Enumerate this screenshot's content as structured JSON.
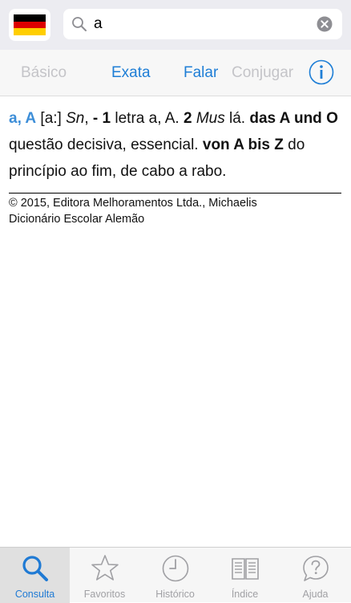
{
  "search": {
    "value": "a",
    "placeholder": ""
  },
  "language_flag": {
    "country": "Germany",
    "colors": [
      "#000000",
      "#dd0000",
      "#ffce00"
    ]
  },
  "options": {
    "basico": "Básico",
    "exata": "Exata",
    "falar": "Falar",
    "conjugar": "Conjugar",
    "info_icon": "info-icon"
  },
  "entry": {
    "headword": "a, A",
    "pronunciation": "[a:]",
    "pos": "Sn",
    "sep1": ",",
    "sense1_num": "- 1",
    "sense1_text": "letra a, A.",
    "sense2_num": "2",
    "sense2_domain": "Mus",
    "sense2_text": "lá.",
    "phrase1": "das A und O",
    "phrase1_text": "questão decisiva, essencial.",
    "phrase2": "von A bis Z",
    "phrase2_text": "do princípio ao fim, de cabo a rabo."
  },
  "copyright": {
    "line1": "© 2015, Editora Melhoramentos Ltda., Michaelis",
    "line2": "Dicionário Escolar Alemão"
  },
  "tabs": [
    {
      "label": "Consulta",
      "icon": "magnifier-icon",
      "selected": true
    },
    {
      "label": "Favoritos",
      "icon": "star-icon",
      "selected": false
    },
    {
      "label": "Histórico",
      "icon": "clock-icon",
      "selected": false
    },
    {
      "label": "Índice",
      "icon": "book-icon",
      "selected": false
    },
    {
      "label": "Ajuda",
      "icon": "question-bubble-icon",
      "selected": false
    }
  ],
  "colors": {
    "accent": "#1e7ed6",
    "headword": "#3d8ed8",
    "disabled": "#c4c4c8",
    "tab_inactive": "#a0a0a4"
  }
}
